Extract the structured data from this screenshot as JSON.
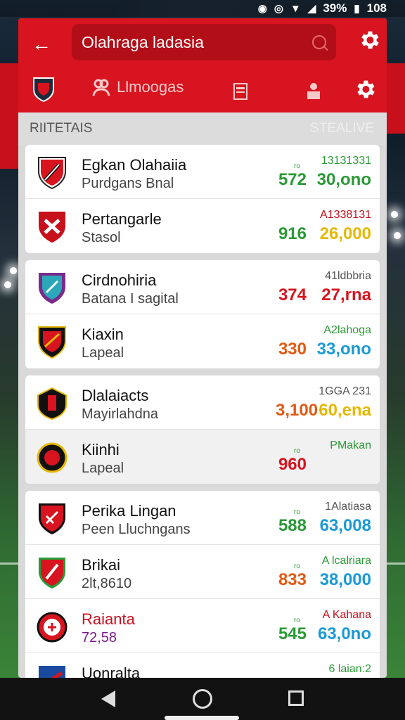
{
  "status": {
    "battery": "39%",
    "time": "108"
  },
  "search": {
    "value": "Olahraga ladasia"
  },
  "tabs": [
    {
      "label": ""
    },
    {
      "label": "Llmoogas"
    },
    {
      "label": ""
    },
    {
      "label": ""
    },
    {
      "label": ""
    }
  ],
  "section": {
    "left": "RIITETAIS",
    "right": "STEALIVE"
  },
  "groups": [
    {
      "rows": [
        {
          "name": "Egkan Olahaiia",
          "sub": "Purdgans Bnal",
          "small": "ro",
          "score": "572",
          "meta": "13131331",
          "value": "30,ono",
          "score_color": "#2a9a36",
          "value_color": "#2a9a36",
          "name_color": "#111",
          "sub_color": "#444",
          "meta_color": "#2a9a36",
          "crest": "a"
        },
        {
          "name": "Pertangarle",
          "sub": "Stasol",
          "small": "",
          "score": "916",
          "meta": "A1338131",
          "value": "26,000",
          "score_color": "#2a9a36",
          "value_color": "#e6b800",
          "name_color": "#111",
          "sub_color": "#444",
          "meta_color": "#c8101d",
          "crest": "b"
        }
      ]
    },
    {
      "rows": [
        {
          "name": "Cirdnohiria",
          "sub": "Batana I sagital",
          "small": "",
          "score": "374",
          "meta": "41ldbbria",
          "value": "27,rna",
          "score_color": "#d7141f",
          "value_color": "#d7141f",
          "name_color": "#111",
          "sub_color": "#444",
          "meta_color": "#555",
          "crest": "c"
        },
        {
          "name": "Kiaxin",
          "sub": "Lapeal",
          "small": "",
          "score": "330",
          "meta": "A2lahoga",
          "value": "33,ono",
          "score_color": "#e15a14",
          "value_color": "#1a9ad6",
          "name_color": "#111",
          "sub_color": "#444",
          "meta_color": "#2a9a36",
          "crest": "d"
        }
      ]
    },
    {
      "rows": [
        {
          "name": "Dlalaiacts",
          "sub": "Mayirlahdna",
          "small": "",
          "score": "3,100",
          "meta": "1GGA 231",
          "value": "60,ena",
          "score_color": "#e15a14",
          "value_color": "#e6b800",
          "name_color": "#111",
          "sub_color": "#444",
          "meta_color": "#555",
          "crest": "e"
        },
        {
          "name": "Kiinhi",
          "sub": "Lapeal",
          "small": "ro",
          "score": "960",
          "meta": "PMakan",
          "value": "",
          "score_color": "#d7141f",
          "value_color": "#111",
          "name_color": "#111",
          "sub_color": "#444",
          "meta_color": "#2a9a36",
          "crest": "f"
        }
      ]
    },
    {
      "rows": [
        {
          "name": "Perika Lingan",
          "sub": "Peen Lluchngans",
          "small": "ro",
          "score": "588",
          "meta": "1Alatiasa",
          "value": "63,008",
          "score_color": "#2a9a36",
          "value_color": "#1a9ad6",
          "name_color": "#111",
          "sub_color": "#444",
          "meta_color": "#555",
          "crest": "g"
        },
        {
          "name": "Brikai",
          "sub": "2lt,8610",
          "small": "ro",
          "score": "833",
          "meta": "A lcalriara",
          "value": "38,000",
          "score_color": "#e15a14",
          "value_color": "#1a9ad6",
          "name_color": "#111",
          "sub_color": "#444",
          "meta_color": "#2a9a36",
          "crest": "h"
        },
        {
          "name": "Raianta",
          "sub": "72,58",
          "small": "ro",
          "score": "545",
          "meta": "A Kahana",
          "value": "63,0no",
          "score_color": "#2a9a36",
          "value_color": "#1a9ad6",
          "name_color": "#c8101d",
          "sub_color": "#7a1a8a",
          "meta_color": "#c8101d",
          "crest": "i"
        },
        {
          "name": "Uonralta",
          "sub": "",
          "small": "",
          "score": "",
          "meta": "6 laian:2",
          "value": "",
          "score_color": "#2a9a36",
          "value_color": "#1a9ad6",
          "name_color": "#111",
          "sub_color": "#444",
          "meta_color": "#2a9a36",
          "crest": "j"
        }
      ]
    }
  ]
}
